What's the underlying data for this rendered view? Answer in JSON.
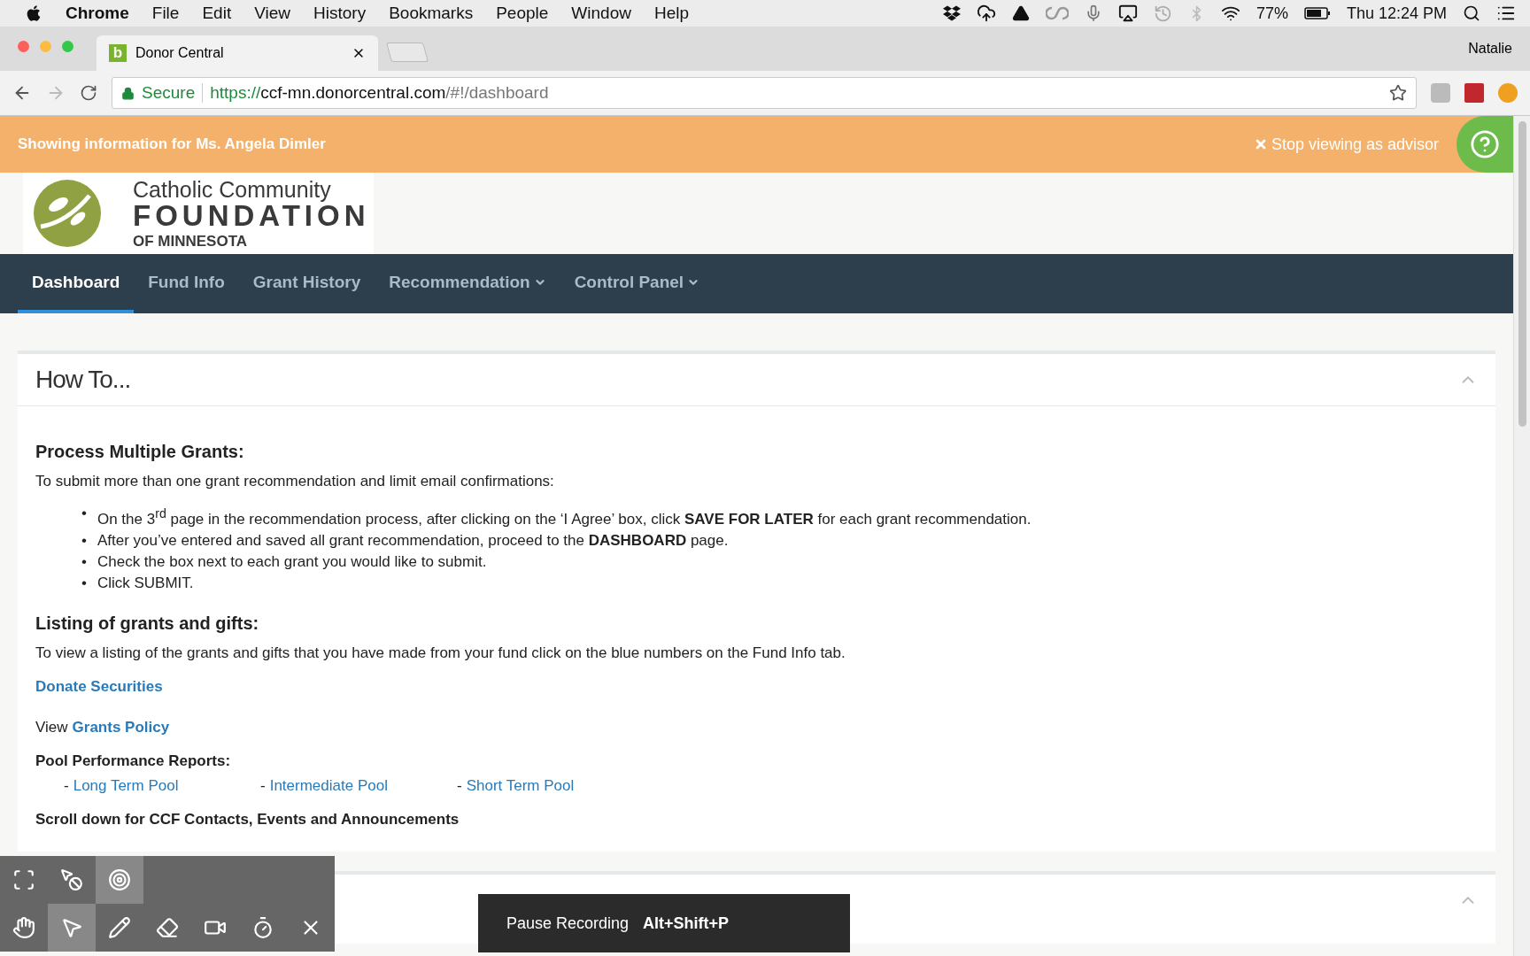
{
  "menubar": {
    "app": "Chrome",
    "items": [
      "File",
      "Edit",
      "View",
      "History",
      "Bookmarks",
      "People",
      "Window",
      "Help"
    ],
    "battery": "77%",
    "clock": "Thu 12:24 PM"
  },
  "browser": {
    "tab": {
      "title": "Donor Central",
      "favicon": "b"
    },
    "profile": "Natalie",
    "url": {
      "secure": "Secure",
      "scheme": "https://",
      "host": "ccf-mn.donorcentral.com",
      "path": "/#!/dashboard"
    }
  },
  "banner": {
    "text": "Showing information for Ms. Angela Dimler",
    "stop": "Stop viewing as advisor"
  },
  "logo": {
    "line_1": "Catholic Community",
    "line_2": "FOUNDATION",
    "line_3": "OF MINNESOTA"
  },
  "nav": [
    {
      "label": "Dashboard",
      "selected": true,
      "dropdown": false
    },
    {
      "label": "Fund Info",
      "selected": false,
      "dropdown": false
    },
    {
      "label": "Grant History",
      "selected": false,
      "dropdown": false
    },
    {
      "label": "Recommendation",
      "selected": false,
      "dropdown": true
    },
    {
      "label": "Control Panel",
      "selected": false,
      "dropdown": true
    }
  ],
  "panel": {
    "title": "How To...",
    "expanded": true,
    "blocks": [
      {
        "kind": "heading",
        "text": "Process Multiple Grants:"
      },
      {
        "kind": "paragraph",
        "text": "To submit more than one grant recommendation and limit email confirmations:"
      },
      {
        "kind": "bullets",
        "items": [
          {
            "marker": "•",
            "text": "On the 3$^{rd}$ page in the recommendation process, after clicking on the ‘I Agree’ box, click **SAVE FOR LATER** for each grant recommendation."
          },
          {
            "marker": "•",
            "text": "After you’ve entered and saved all grant recommendation, proceed to the **DASHBOARD** page."
          },
          {
            "marker": "•",
            "text": "Check the box next to each grant you would like to submit."
          },
          {
            "marker": "•",
            "text": "Click SUBMIT."
          }
        ]
      },
      {
        "kind": "heading",
        "text": "Listing of grants and gifts:"
      },
      {
        "kind": "paragraph",
        "text": "To view a listing of the grants and gifts that you have made from your fund click on the blue numbers on the Fund Info tab."
      },
      {
        "kind": "link",
        "text": "Donate Securities"
      },
      {
        "kind": "labeled_link",
        "label": "View",
        "text": "Grants Policy"
      },
      {
        "kind": "subheading",
        "text": "Pool Performance Reports:"
      },
      {
        "kind": "pools",
        "items": [
          {
            "dash": "-",
            "text": "Long Term Pool"
          },
          {
            "dash": "-",
            "text": "Intermediate Pool"
          },
          {
            "dash": "-",
            "text": "Short Term Pool"
          }
        ]
      },
      {
        "kind": "subheading",
        "text": "Scroll down for CCF Contacts, Events and Announcements"
      }
    ]
  },
  "next_panel": {
    "expanded": true
  },
  "recorder": {
    "top": [
      {
        "kind": "capture",
        "selected": false
      },
      {
        "kind": "cursor_off",
        "selected": false
      },
      {
        "kind": "cursor_ring",
        "selected": true
      }
    ],
    "bottom": [
      {
        "kind": "hand",
        "selected": false
      },
      {
        "kind": "pointer",
        "selected": true
      },
      {
        "kind": "pen",
        "selected": false
      },
      {
        "kind": "eraser",
        "selected": false
      },
      {
        "kind": "camera",
        "selected": false
      },
      {
        "kind": "timer",
        "selected": false
      },
      {
        "kind": "close",
        "selected": false
      }
    ],
    "toast": {
      "text": "Pause Recording",
      "shortcut": "Alt+Shift+P"
    }
  }
}
